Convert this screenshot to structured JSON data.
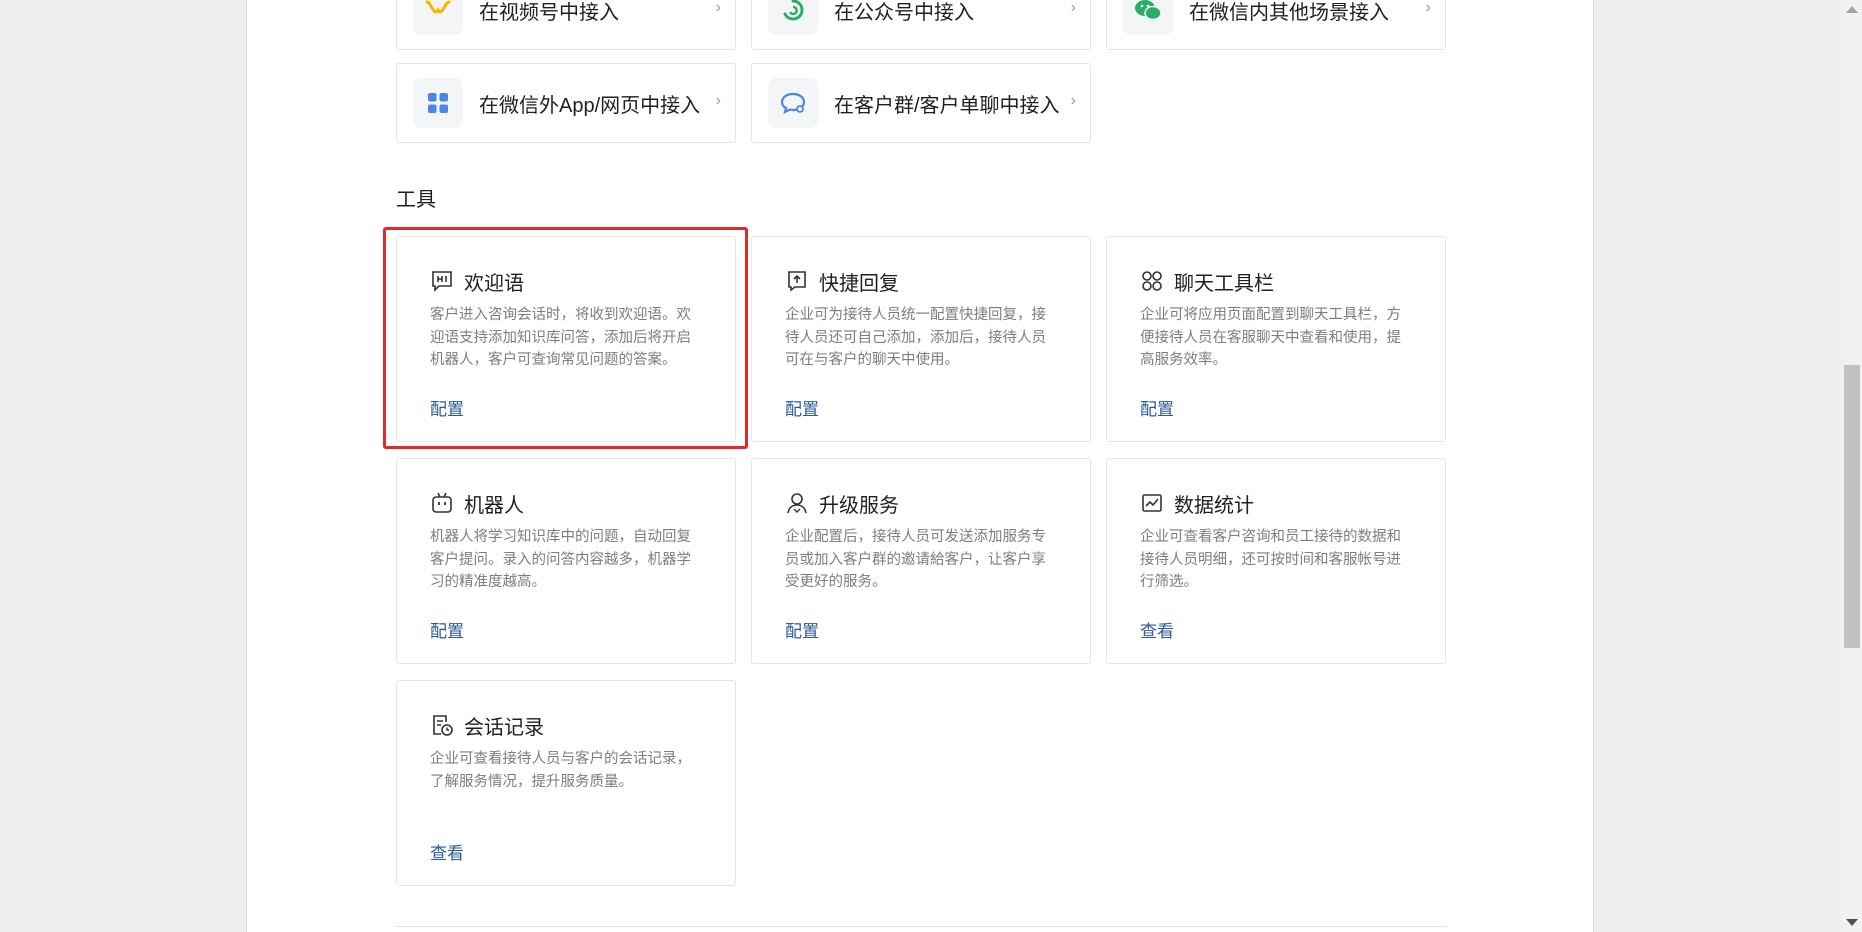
{
  "entries": [
    {
      "label": "在视频号中接入",
      "icon": "channels-icon",
      "color": "#f7b500"
    },
    {
      "label": "在公众号中接入",
      "icon": "official-account-icon",
      "color": "#2aae67"
    },
    {
      "label": "在微信内其他场景接入",
      "icon": "wechat-icon",
      "color": "#2aae67"
    },
    {
      "label": "在微信外App/网页中接入",
      "icon": "app-grid-icon",
      "color": "#4a86e8"
    },
    {
      "label": "在客户群/客户单聊中接入",
      "icon": "chat-bubble-icon",
      "color": "#4a86e8"
    }
  ],
  "section_title": "工具",
  "tools": [
    {
      "title": "欢迎语",
      "icon": "hi-message-icon",
      "desc": "客户进入咨询会话时，将收到欢迎语。欢迎语支持添加知识库问答，添加后将开启机器人，客户可查询常见问题的答案。",
      "link": "配置"
    },
    {
      "title": "快捷回复",
      "icon": "quick-reply-icon",
      "desc": "企业可为接待人员统一配置快捷回复，接待人员还可自己添加，添加后，接待人员可在与客户的聊天中使用。",
      "link": "配置"
    },
    {
      "title": "聊天工具栏",
      "icon": "toolbar-icon",
      "desc": "企业可将应用页面配置到聊天工具栏，方便接待人员在客服聊天中查看和使用，提高服务效率。",
      "link": "配置"
    },
    {
      "title": "机器人",
      "icon": "robot-icon",
      "desc": "机器人将学习知识库中的问题，自动回复客户提问。录入的问答内容越多，机器学习的精准度越高。",
      "link": "配置"
    },
    {
      "title": "升级服务",
      "icon": "upgrade-service-icon",
      "desc": "企业配置后，接待人员可发送添加服务专员或加入客户群的邀请給客户，让客户享受更好的服务。",
      "link": "配置"
    },
    {
      "title": "数据统计",
      "icon": "statistics-icon",
      "desc": "企业可查看客户咨询和员工接待的数据和接待人员明细，还可按时间和客服帐号进行筛选。",
      "link": "查看"
    },
    {
      "title": "会话记录",
      "icon": "chat-record-icon",
      "desc": "企业可查看接待人员与客户的会话记录，了解服务情况，提升服务质量。",
      "link": "查看"
    }
  ],
  "colors": {
    "link": "#2b5b9a",
    "highlight": "#e22a2a"
  }
}
